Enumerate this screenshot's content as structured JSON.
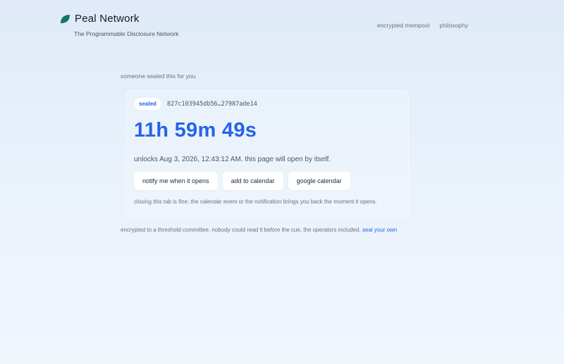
{
  "brand": {
    "name": "Peal Network",
    "tagline": "The Programmable Disclosure Network",
    "logo_icon": "leaf-icon",
    "logo_color": "#0f766e"
  },
  "nav": {
    "items": [
      {
        "label": "encrypted mempool"
      },
      {
        "label": "philosophy"
      }
    ]
  },
  "intro": "someone sealed this for you",
  "card": {
    "badge": "sealed",
    "hash": "827c103945db56…27987ade14",
    "countdown": "11h 59m 49s",
    "unlock_text": "unlocks Aug 3, 2026, 12:43:12 AM. this page will open by itself.",
    "buttons": {
      "notify": "notify me when it opens",
      "calendar": "add to calendar",
      "google": "google calendar"
    },
    "note": "closing this tab is fine: the calendar event or the notification brings you back the moment it opens."
  },
  "footer": {
    "text": "encrypted to a threshold committee. nobody could read it before the cue, the operators included.",
    "link": "seal your own"
  },
  "colors": {
    "accent": "#2563eb",
    "logo": "#0f766e"
  }
}
